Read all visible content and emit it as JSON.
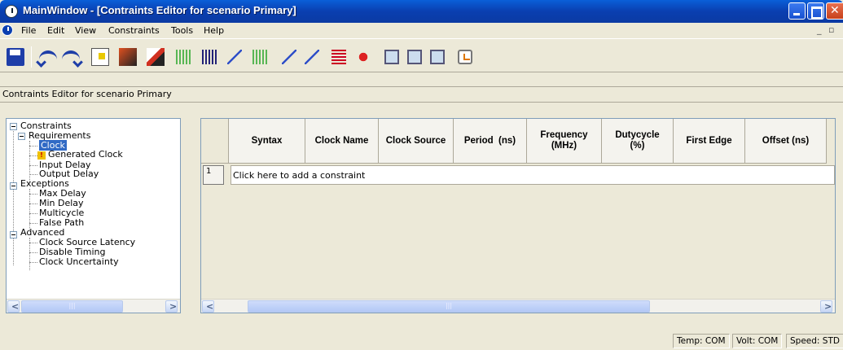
{
  "window": {
    "title": "MainWindow - [Contraints Editor for scenario Primary]"
  },
  "menu": {
    "items": [
      "File",
      "Edit",
      "View",
      "Constraints",
      "Tools",
      "Help"
    ]
  },
  "toolbar": {
    "icons": [
      "save-icon",
      "undo-icon",
      "redo-icon",
      "import-icon",
      "generate-icon",
      "export-icon",
      "clock-icon",
      "generated-clock-icon",
      "input-delay-icon",
      "output-delay-icon",
      "max-delay-icon",
      "min-delay-icon",
      "multicycle-icon",
      "false-path-icon",
      "clock-source-latency-icon",
      "disable-timing-icon",
      "clock-uncertainty-icon",
      "check-icon"
    ]
  },
  "document_label": "Contraints Editor for scenario Primary",
  "tree": {
    "root": "Constraints",
    "groups": [
      {
        "label": "Requirements",
        "children": [
          "Clock",
          "Generated Clock",
          "Input Delay",
          "Output Delay"
        ]
      },
      {
        "label": "Exceptions",
        "children": [
          "Max Delay",
          "Min Delay",
          "Multicycle",
          "False Path"
        ]
      },
      {
        "label": "Advanced",
        "children": [
          "Clock Source Latency",
          "Disable Timing",
          "Clock Uncertainty"
        ]
      }
    ],
    "selected": "Clock"
  },
  "grid": {
    "columns": [
      "Syntax",
      "Clock Name",
      "Clock Source",
      "Period  (ns)",
      "Frequency (MHz)",
      "Dutycycle (%)",
      "First Edge",
      "Offset (ns)"
    ],
    "row_number": "1",
    "add_row_text": "Click here to add a constraint"
  },
  "status": {
    "temp": "Temp: COM",
    "volt": "Volt: COM",
    "speed": "Speed: STD"
  }
}
